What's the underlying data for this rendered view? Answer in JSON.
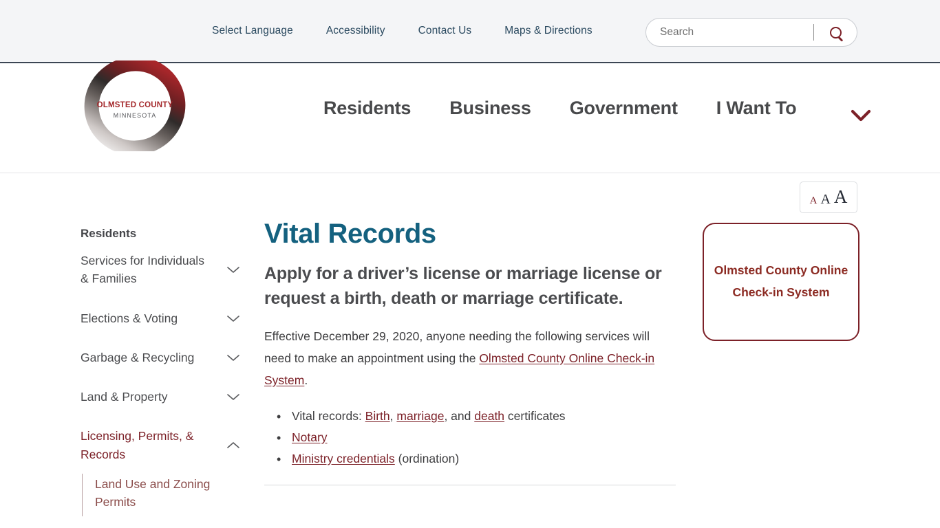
{
  "utility": {
    "links": [
      {
        "label": "Select Language",
        "name": "select-language"
      },
      {
        "label": "Accessibility",
        "name": "accessibility"
      },
      {
        "label": "Contact Us",
        "name": "contact-us"
      },
      {
        "label": "Maps & Directions",
        "name": "maps-directions"
      }
    ],
    "search": {
      "placeholder": "Search",
      "value": "",
      "icon": "search-icon"
    }
  },
  "header": {
    "logo": {
      "line1": "OLMSTED COUNTY",
      "line2": "MINNESOTA",
      "alt": "Olmsted County Minnesota logo"
    },
    "nav": [
      {
        "label": "Residents"
      },
      {
        "label": "Business"
      },
      {
        "label": "Government"
      },
      {
        "label": "I Want To"
      }
    ],
    "nav_caret_icon": "chevron-down-icon"
  },
  "font_size_widget": {
    "small": "A",
    "medium": "A",
    "large": "A"
  },
  "sidebar": {
    "title": "Residents",
    "items": [
      {
        "label": "Services for Individuals & Families",
        "expanded": false,
        "active": false
      },
      {
        "label": "Elections & Voting",
        "expanded": false,
        "active": false
      },
      {
        "label": "Garbage & Recycling",
        "expanded": false,
        "active": false
      },
      {
        "label": "Land & Property",
        "expanded": false,
        "active": false
      },
      {
        "label": "Licensing, Permits, & Records",
        "expanded": true,
        "active": true
      }
    ],
    "sub_items": [
      {
        "label": "Land Use and Zoning Permits"
      }
    ]
  },
  "main": {
    "title": "Vital Records",
    "subtitle": "Apply for a driver’s license or marriage license or request a birth, death or marriage certificate.",
    "intro": {
      "before_link": "Effective December 29, 2020, anyone needing the following services will need to make an appointment using the ",
      "link": "Olmsted County Online Check-in System",
      "after_link": "."
    },
    "list": [
      {
        "parts": [
          {
            "text": "Vital records: ",
            "link": false
          },
          {
            "text": "Birth",
            "link": true
          },
          {
            "text": ", ",
            "link": false
          },
          {
            "text": "marriage",
            "link": true
          },
          {
            "text": ", and ",
            "link": false
          },
          {
            "text": "death",
            "link": true
          },
          {
            "text": " certificates",
            "link": false
          }
        ]
      },
      {
        "parts": [
          {
            "text": "Notary",
            "link": true
          }
        ]
      },
      {
        "parts": [
          {
            "text": "Ministry credentials",
            "link": true
          },
          {
            "text": " (ordination)",
            "link": false
          }
        ]
      }
    ]
  },
  "right_rail": {
    "cta_label": "Olmsted County Online Check-in System"
  },
  "colors": {
    "brand_maroon": "#7c2128",
    "title_teal": "#14617f",
    "utility_link": "#2b4a60",
    "nav_text": "#48494b",
    "utility_bg": "#f4f5f7"
  }
}
